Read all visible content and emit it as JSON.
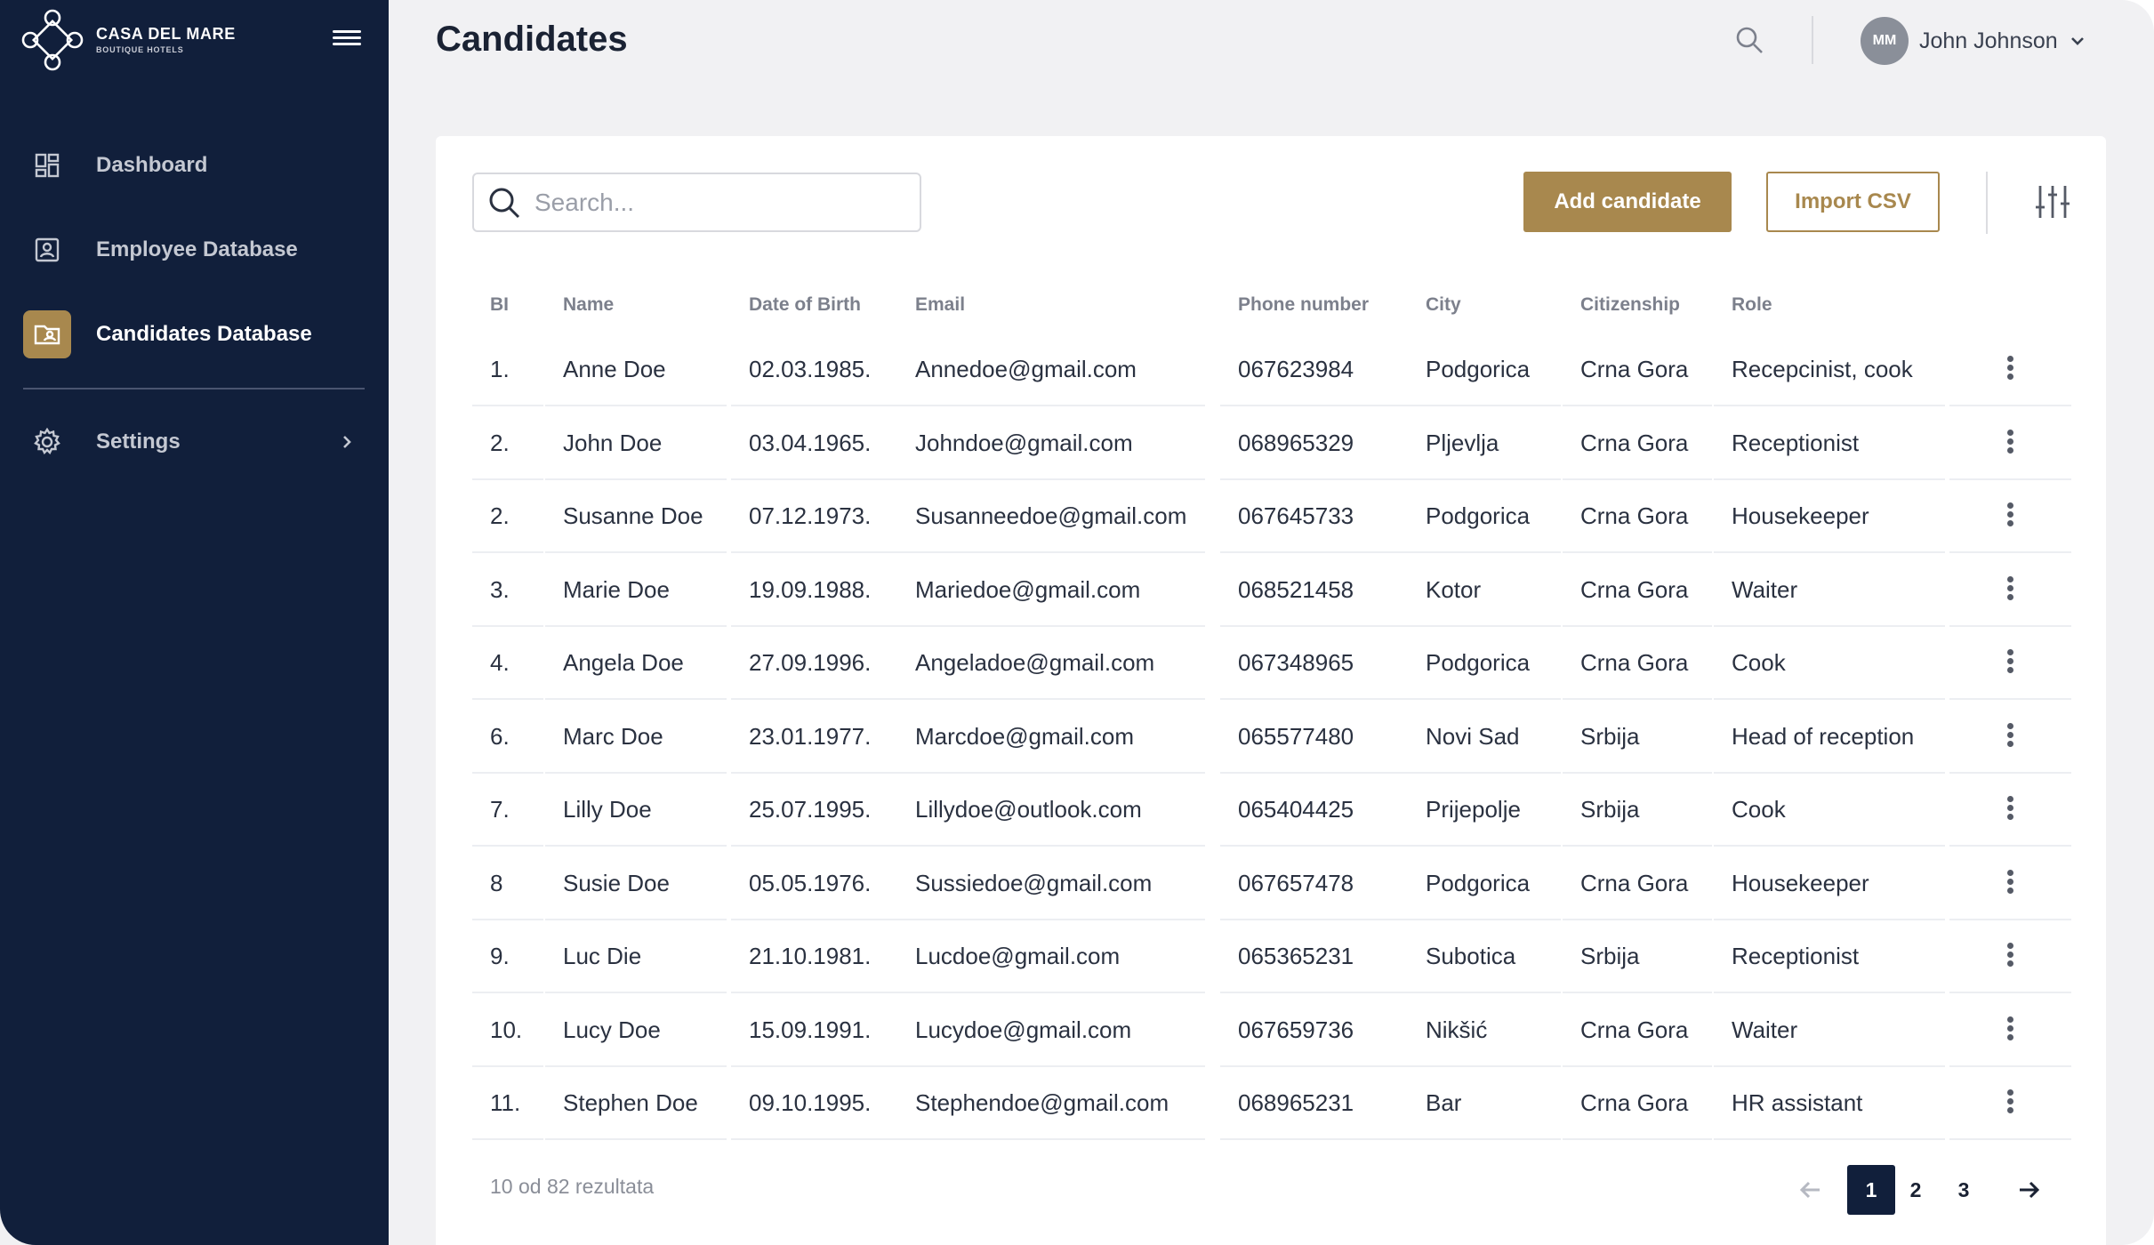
{
  "brand": {
    "name": "CASA DEL MARE",
    "tagline": "BOUTIQUE HOTELS"
  },
  "sidebar": {
    "items": [
      {
        "label": "Dashboard",
        "icon": "dashboard-icon"
      },
      {
        "label": "Employee Database",
        "icon": "id-badge-icon"
      },
      {
        "label": "Candidates Database",
        "icon": "folder-person-icon",
        "active": true
      },
      {
        "label": "Settings",
        "icon": "gear-icon",
        "has_submenu": true
      }
    ]
  },
  "header": {
    "title": "Candidates",
    "user": {
      "initials": "MM",
      "name": "John Johnson"
    }
  },
  "toolbar": {
    "search_placeholder": "Search...",
    "add_label": "Add candidate",
    "import_label": "Import CSV"
  },
  "table": {
    "columns": [
      "BI",
      "Name",
      "Date of Birth",
      "Email",
      "Phone number",
      "City",
      "Citizenship",
      "Role"
    ],
    "rows": [
      [
        "1.",
        "Anne Doe",
        "02.03.1985.",
        "Annedoe@gmail.com",
        "067623984",
        "Podgorica",
        "Crna Gora",
        "Recepcinist, cook"
      ],
      [
        "2.",
        "John Doe",
        "03.04.1965.",
        "Johndoe@gmail.com",
        "068965329",
        "Pljevlja",
        "Crna Gora",
        "Receptionist"
      ],
      [
        "2.",
        "Susanne Doe",
        "07.12.1973.",
        "Susanneedoe@gmail.com",
        "067645733",
        "Podgorica",
        "Crna Gora",
        "Housekeeper"
      ],
      [
        "3.",
        "Marie Doe",
        "19.09.1988.",
        "Mariedoe@gmail.com",
        "068521458",
        "Kotor",
        "Crna Gora",
        "Waiter"
      ],
      [
        "4.",
        "Angela Doe",
        "27.09.1996.",
        "Angeladoe@gmail.com",
        "067348965",
        "Podgorica",
        "Crna Gora",
        "Cook"
      ],
      [
        "6.",
        "Marc Doe",
        "23.01.1977.",
        "Marcdoe@gmail.com",
        "065577480",
        "Novi Sad",
        "Srbija",
        "Head of reception"
      ],
      [
        "7.",
        "Lilly Doe",
        "25.07.1995.",
        "Lillydoe@outlook.com",
        "065404425",
        "Prijepolje",
        "Srbija",
        "Cook"
      ],
      [
        "8",
        "Susie Doe",
        "05.05.1976.",
        "Sussiedoe@gmail.com",
        "067657478",
        "Podgorica",
        "Crna Gora",
        "Housekeeper"
      ],
      [
        "9.",
        "Luc Die",
        "21.10.1981.",
        "Lucdoe@gmail.com",
        "065365231",
        "Subotica",
        "Srbija",
        "Receptionist"
      ],
      [
        "10.",
        "Lucy Doe",
        "15.09.1991.",
        "Lucydoe@gmail.com",
        "067659736",
        "Nikšić",
        "Crna Gora",
        "Waiter"
      ],
      [
        "11.",
        "Stephen Doe",
        "09.10.1995.",
        "Stephendoe@gmail.com",
        "068965231",
        "Bar",
        "Crna Gora",
        "HR assistant"
      ]
    ]
  },
  "footer": {
    "result_text": "10 od 82 rezultata",
    "pages": [
      "1",
      "2",
      "3"
    ],
    "current_page": "1"
  },
  "colors": {
    "sidebar_bg": "#111f3b",
    "accent_gold": "#a8884e",
    "page_bg": "#f1f1f3"
  }
}
